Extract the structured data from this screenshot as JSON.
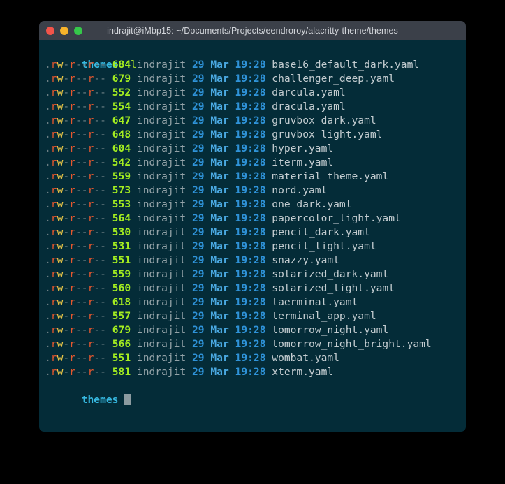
{
  "window": {
    "title": "indrajit@iMbp15: ~/Documents/Projects/eendroroy/alacritty-theme/themes",
    "traffic_lights": [
      {
        "name": "close",
        "color": "#f3544a"
      },
      {
        "name": "minimize",
        "color": "#f7b32b"
      },
      {
        "name": "zoom",
        "color": "#35c84a"
      }
    ],
    "background": "#042c38",
    "titlebar_background": "#3b4049"
  },
  "terminal": {
    "prompt_top": {
      "prompt": "themes",
      "command": "l"
    },
    "prompt_bottom": {
      "prompt": "themes",
      "command": ""
    },
    "permissions": {
      "dot": ".",
      "owner": "rw-",
      "group": "r--",
      "other": "r--"
    },
    "columns": {
      "user": "indrajit",
      "day": "29",
      "month": "Mar",
      "time": "19:28"
    },
    "rows": [
      {
        "perm": ".rw-r--r--",
        "size": "684",
        "user": "indrajit",
        "day": "29",
        "month": "Mar",
        "time": "19:28",
        "name": "base16_default_dark.yaml"
      },
      {
        "perm": ".rw-r--r--",
        "size": "679",
        "user": "indrajit",
        "day": "29",
        "month": "Mar",
        "time": "19:28",
        "name": "challenger_deep.yaml"
      },
      {
        "perm": ".rw-r--r--",
        "size": "552",
        "user": "indrajit",
        "day": "29",
        "month": "Mar",
        "time": "19:28",
        "name": "darcula.yaml"
      },
      {
        "perm": ".rw-r--r--",
        "size": "554",
        "user": "indrajit",
        "day": "29",
        "month": "Mar",
        "time": "19:28",
        "name": "dracula.yaml"
      },
      {
        "perm": ".rw-r--r--",
        "size": "647",
        "user": "indrajit",
        "day": "29",
        "month": "Mar",
        "time": "19:28",
        "name": "gruvbox_dark.yaml"
      },
      {
        "perm": ".rw-r--r--",
        "size": "648",
        "user": "indrajit",
        "day": "29",
        "month": "Mar",
        "time": "19:28",
        "name": "gruvbox_light.yaml"
      },
      {
        "perm": ".rw-r--r--",
        "size": "604",
        "user": "indrajit",
        "day": "29",
        "month": "Mar",
        "time": "19:28",
        "name": "hyper.yaml"
      },
      {
        "perm": ".rw-r--r--",
        "size": "542",
        "user": "indrajit",
        "day": "29",
        "month": "Mar",
        "time": "19:28",
        "name": "iterm.yaml"
      },
      {
        "perm": ".rw-r--r--",
        "size": "559",
        "user": "indrajit",
        "day": "29",
        "month": "Mar",
        "time": "19:28",
        "name": "material_theme.yaml"
      },
      {
        "perm": ".rw-r--r--",
        "size": "573",
        "user": "indrajit",
        "day": "29",
        "month": "Mar",
        "time": "19:28",
        "name": "nord.yaml"
      },
      {
        "perm": ".rw-r--r--",
        "size": "553",
        "user": "indrajit",
        "day": "29",
        "month": "Mar",
        "time": "19:28",
        "name": "one_dark.yaml"
      },
      {
        "perm": ".rw-r--r--",
        "size": "564",
        "user": "indrajit",
        "day": "29",
        "month": "Mar",
        "time": "19:28",
        "name": "papercolor_light.yaml"
      },
      {
        "perm": ".rw-r--r--",
        "size": "530",
        "user": "indrajit",
        "day": "29",
        "month": "Mar",
        "time": "19:28",
        "name": "pencil_dark.yaml"
      },
      {
        "perm": ".rw-r--r--",
        "size": "531",
        "user": "indrajit",
        "day": "29",
        "month": "Mar",
        "time": "19:28",
        "name": "pencil_light.yaml"
      },
      {
        "perm": ".rw-r--r--",
        "size": "551",
        "user": "indrajit",
        "day": "29",
        "month": "Mar",
        "time": "19:28",
        "name": "snazzy.yaml"
      },
      {
        "perm": ".rw-r--r--",
        "size": "559",
        "user": "indrajit",
        "day": "29",
        "month": "Mar",
        "time": "19:28",
        "name": "solarized_dark.yaml"
      },
      {
        "perm": ".rw-r--r--",
        "size": "560",
        "user": "indrajit",
        "day": "29",
        "month": "Mar",
        "time": "19:28",
        "name": "solarized_light.yaml"
      },
      {
        "perm": ".rw-r--r--",
        "size": "618",
        "user": "indrajit",
        "day": "29",
        "month": "Mar",
        "time": "19:28",
        "name": "taerminal.yaml"
      },
      {
        "perm": ".rw-r--r--",
        "size": "557",
        "user": "indrajit",
        "day": "29",
        "month": "Mar",
        "time": "19:28",
        "name": "terminal_app.yaml"
      },
      {
        "perm": ".rw-r--r--",
        "size": "679",
        "user": "indrajit",
        "day": "29",
        "month": "Mar",
        "time": "19:28",
        "name": "tomorrow_night.yaml"
      },
      {
        "perm": ".rw-r--r--",
        "size": "566",
        "user": "indrajit",
        "day": "29",
        "month": "Mar",
        "time": "19:28",
        "name": "tomorrow_night_bright.yaml"
      },
      {
        "perm": ".rw-r--r--",
        "size": "551",
        "user": "indrajit",
        "day": "29",
        "month": "Mar",
        "time": "19:28",
        "name": "wombat.yaml"
      },
      {
        "perm": ".rw-r--r--",
        "size": "581",
        "user": "indrajit",
        "day": "29",
        "month": "Mar",
        "time": "19:28",
        "name": "xterm.yaml"
      }
    ]
  }
}
